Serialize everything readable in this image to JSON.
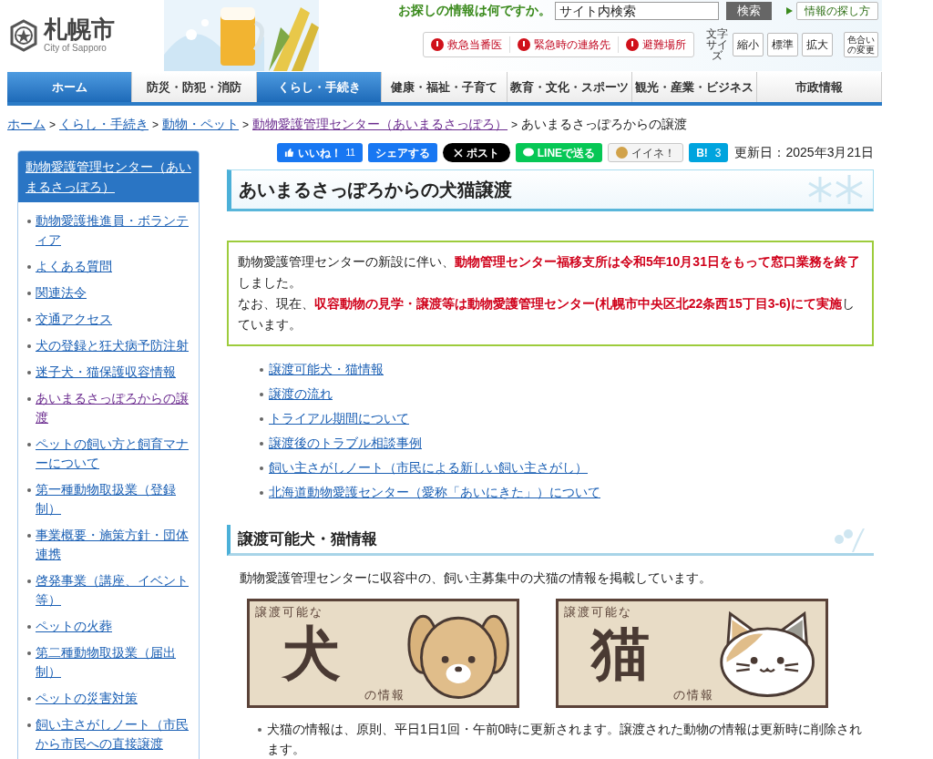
{
  "header": {
    "logo": {
      "name": "札幌市",
      "sub": "City of Sapporo"
    },
    "search": {
      "prompt": "お探しの情報は何ですか。",
      "value": "サイト内検索",
      "button": "検索"
    },
    "info_link": "情報の探し方",
    "emergency_links": [
      "救急当番医",
      "緊急時の連絡先",
      "避難場所"
    ],
    "font_size": {
      "label": "文字サイズ",
      "buttons": [
        "縮小",
        "標準",
        "拡大"
      ]
    },
    "color_change": "色合いの変更"
  },
  "nav": [
    {
      "label": "ホーム",
      "selected": true
    },
    {
      "label": "防災・防犯・消防",
      "selected": false
    },
    {
      "label": "くらし・手続き",
      "selected": true
    },
    {
      "label": "健康・福祉・子育て",
      "selected": false
    },
    {
      "label": "教育・文化・スポーツ",
      "selected": false
    },
    {
      "label": "観光・産業・ビジネス",
      "selected": false
    },
    {
      "label": "市政情報",
      "selected": false
    }
  ],
  "breadcrumb": {
    "links": [
      {
        "label": "ホーム",
        "visited": false
      },
      {
        "label": "くらし・手続き",
        "visited": false
      },
      {
        "label": "動物・ペット",
        "visited": false
      },
      {
        "label": "動物愛護管理センター（あいまるさっぽろ）",
        "visited": true
      }
    ],
    "separator": ">",
    "current": "あいまるさっぽろからの譲渡"
  },
  "sidebar": {
    "title": "動物愛護管理センター（あいまるさっぽろ）",
    "items": [
      {
        "label": "動物愛護推進員・ボランティア",
        "visited": false
      },
      {
        "label": "よくある質問",
        "visited": false
      },
      {
        "label": "関連法令",
        "visited": false
      },
      {
        "label": "交通アクセス",
        "visited": false
      },
      {
        "label": "犬の登録と狂犬病予防注射",
        "visited": false
      },
      {
        "label": "迷子犬・猫保護収容情報",
        "visited": false
      },
      {
        "label": "あいまるさっぽろからの譲渡",
        "visited": true
      },
      {
        "label": "ペットの飼い方と飼育マナーについて",
        "visited": false
      },
      {
        "label": "第一種動物取扱業（登録制）",
        "visited": false
      },
      {
        "label": "事業概要・施策方針・団体連携",
        "visited": false
      },
      {
        "label": "啓発事業（講座、イベント等）",
        "visited": false
      },
      {
        "label": "ペットの火葬",
        "visited": false
      },
      {
        "label": "第二種動物取扱業（届出制）",
        "visited": false
      },
      {
        "label": "ペットの災害対策",
        "visited": false
      },
      {
        "label": "飼い主さがしノート（市民から市民への直接譲渡",
        "visited": false
      }
    ]
  },
  "social": [
    {
      "kind": "like",
      "label": "いいね！",
      "count": "11"
    },
    {
      "kind": "share",
      "label": "シェアする"
    },
    {
      "kind": "x",
      "label": "ポスト"
    },
    {
      "kind": "line",
      "label": "LINEで送る"
    },
    {
      "kind": "mixi",
      "label": "イイネ！"
    },
    {
      "kind": "hatena",
      "label": "B!",
      "count": "3"
    }
  ],
  "updated": "更新日：2025年3月21日",
  "title": "あいまるさっぽろからの犬猫譲渡",
  "notice": [
    "動物愛護管理センターの新設に伴い、**動物管理センター福移支所は令和5年10月31日をもって窓口業務を終了**しました。",
    "なお、現在、**収容動物の見学・譲渡等は動物愛護管理センター(札幌市中央区北22条西15丁目3-6)にて実施**しています。"
  ],
  "toc": [
    {
      "label": "譲渡可能犬・猫情報"
    },
    {
      "label": "譲渡の流れ"
    },
    {
      "label": "トライアル期間について"
    },
    {
      "label": "譲渡後のトラブル相談事例"
    },
    {
      "label": "飼い主さがしノート（市民による新しい飼い主さがし）"
    },
    {
      "label": "北海道動物愛護センター（愛称「あいにきた」）について"
    }
  ],
  "section": {
    "heading": "譲渡可能犬・猫情報",
    "intro": "動物愛護管理センターに収容中の、飼い主募集中の犬猫の情報を掲載しています。",
    "banners": [
      {
        "kind": "dog",
        "top": "譲渡可能な",
        "big": "犬",
        "bottom": "の情報"
      },
      {
        "kind": "cat",
        "top": "譲渡可能な",
        "big": "猫",
        "bottom": "の情報"
      }
    ],
    "notes": [
      "犬猫の情報は、原則、平日1日1回・午前0時に更新されます。譲渡された動物の情報は更新時に削除されます。"
    ]
  }
}
